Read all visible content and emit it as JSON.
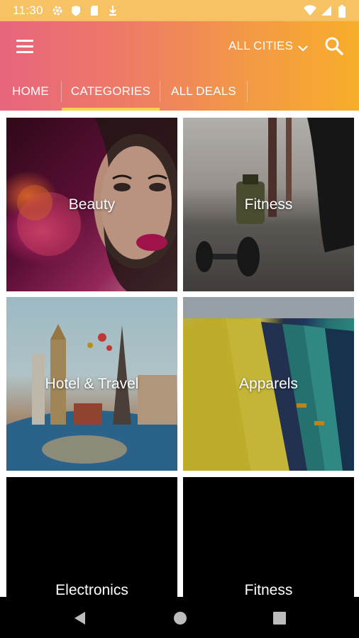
{
  "status_bar": {
    "time": "11:30",
    "icons_left": [
      "settings-icon",
      "shield-icon",
      "sd-card-icon",
      "download-icon"
    ],
    "icons_right": [
      "wifi-icon",
      "signal-icon",
      "battery-icon"
    ],
    "color": "#f6c264"
  },
  "app_bar": {
    "city_label": "ALL CITIES",
    "icons": [
      "menu-icon",
      "chevron-down-icon",
      "search-icon"
    ],
    "gradient": [
      "#e7657d",
      "#f7ae2b"
    ]
  },
  "tabs": [
    {
      "label": "HOME",
      "active": false
    },
    {
      "label": "CATEGORIES",
      "active": true
    },
    {
      "label": "ALL DEALS",
      "active": false
    }
  ],
  "tab_indicator_color": "#f8d44a",
  "categories": [
    {
      "label": "Beauty"
    },
    {
      "label": "Fitness"
    },
    {
      "label": "Hotel & Travel"
    },
    {
      "label": "Apparels"
    },
    {
      "label": "Electronics"
    },
    {
      "label": "Fitness"
    }
  ],
  "nav_bar": {
    "icons": [
      "back-icon",
      "home-icon",
      "recent-apps-icon"
    ]
  }
}
